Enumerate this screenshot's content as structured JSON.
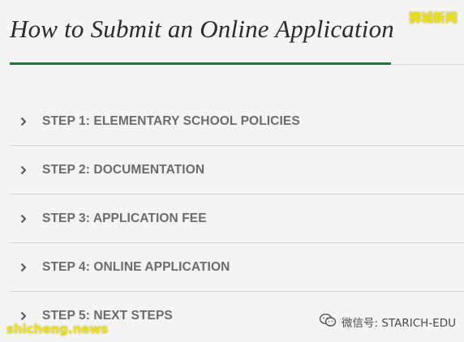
{
  "title": "How to Submit an Online Application",
  "steps": [
    {
      "label": "STEP 1: ELEMENTARY SCHOOL POLICIES"
    },
    {
      "label": "STEP 2: DOCUMENTATION"
    },
    {
      "label": "STEP 3: APPLICATION FEE"
    },
    {
      "label": "STEP 4: ONLINE APPLICATION"
    },
    {
      "label": "STEP 5: NEXT STEPS"
    }
  ],
  "icons": {
    "step": "chevron-right-icon",
    "wechat": "wechat-icon"
  },
  "watermarks": {
    "top_right": "狮城新闻",
    "bottom_left": "shicheng.news",
    "bottom_right": "微信号: STARICH-EDU"
  },
  "colors": {
    "accent": "#1d7a3c",
    "step_text": "#6b6b6b",
    "title": "#2b2b2b",
    "watermark": "#f2e600"
  }
}
